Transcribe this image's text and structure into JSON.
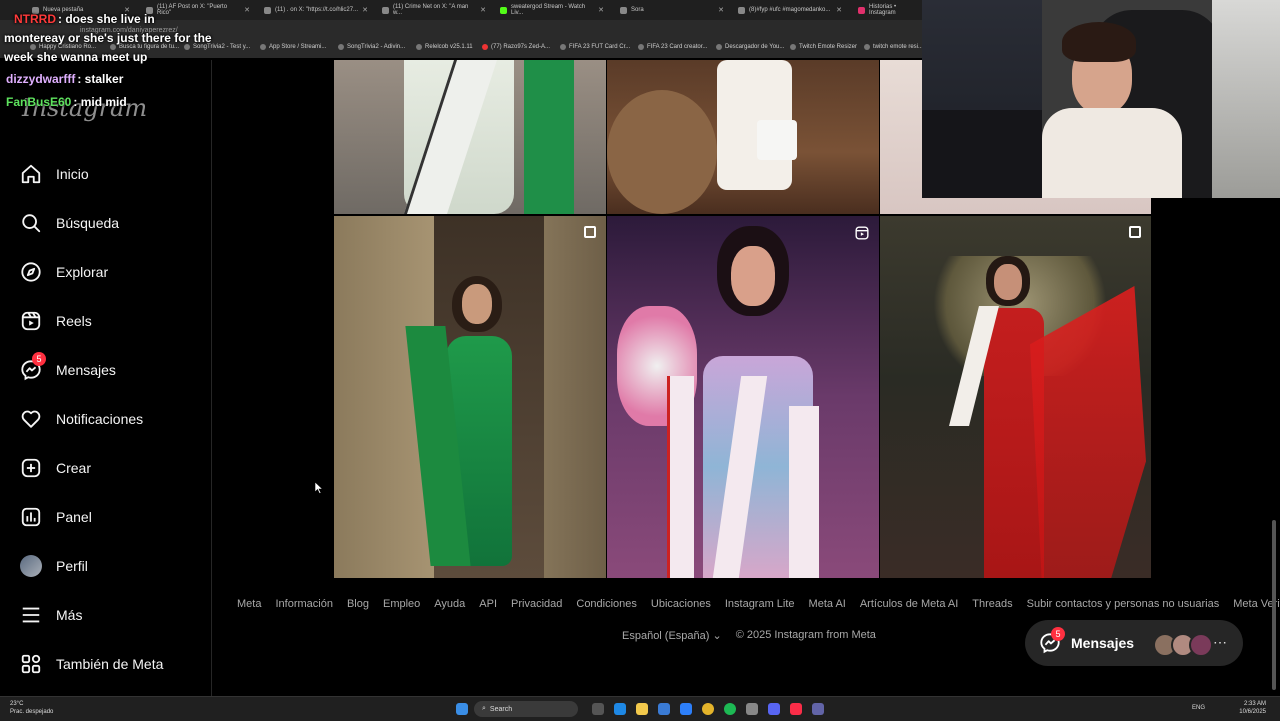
{
  "browser": {
    "tabs": [
      {
        "title": "Nueva pestaña"
      },
      {
        "title": "(11) AF Post on X: \"Puerto Rico\""
      },
      {
        "title": "(11) . on X: \"https://t.co/hlic27..."
      },
      {
        "title": "(11) Crime Net on X: \"A man w..."
      },
      {
        "title": "sweatergod Stream - Watch Liv..."
      },
      {
        "title": "Sora"
      },
      {
        "title": "(8)#fyp #ufc #magomedanko..."
      },
      {
        "title": "Historias • Instagram"
      }
    ],
    "url": "instagram.com/daniyaperezrez/",
    "bookmarks": [
      "Happy Cristiano Ro...",
      "Busca tu figura de tu...",
      "SongTrivia2 - Test y...",
      "App Store / Streami...",
      "SongTrivia2 - Adivin...",
      "Relelcob v25.1.11",
      "(77) Razo97s Zed-A...",
      "FIFA 23 FUT Card Cr...",
      "FIFA 23 Card creator...",
      "Descargador de You...",
      "Twitch Emote Resizer",
      "twitch emote resi..."
    ]
  },
  "chat": [
    {
      "user": "NTRRD",
      "text": ": does she live in",
      "user_color": "#ff3a3a"
    },
    {
      "user": "",
      "text": "montereay or she's just there for the",
      "user_color": "#ffffff"
    },
    {
      "user": "",
      "text": "week she wanna meet up",
      "user_color": "#ffffff"
    },
    {
      "user": "dizzydwarfff",
      "text": ": stalker",
      "user_color": "#e0b0ff"
    },
    {
      "user": "FanBusE60",
      "text": ": mid mid",
      "user_color": "#5ee35e"
    }
  ],
  "sidebar": {
    "logo": "Instagram",
    "items": [
      {
        "label": "Inicio",
        "icon": "home-icon"
      },
      {
        "label": "Búsqueda",
        "icon": "search-icon"
      },
      {
        "label": "Explorar",
        "icon": "compass-icon"
      },
      {
        "label": "Reels",
        "icon": "reels-icon"
      },
      {
        "label": "Mensajes",
        "icon": "messenger-icon",
        "badge": "5"
      },
      {
        "label": "Notificaciones",
        "icon": "heart-icon"
      },
      {
        "label": "Crear",
        "icon": "plus-square-icon"
      },
      {
        "label": "Panel",
        "icon": "chart-icon"
      },
      {
        "label": "Perfil",
        "icon": "avatar"
      },
      {
        "label": "Más",
        "icon": "menu-icon"
      },
      {
        "label": "También de Meta",
        "icon": "meta-apps-icon"
      }
    ]
  },
  "footer": {
    "links": [
      "Meta",
      "Información",
      "Blog",
      "Empleo",
      "Ayuda",
      "API",
      "Privacidad",
      "Condiciones",
      "Ubicaciones",
      "Instagram Lite",
      "Meta AI",
      "Artículos de Meta AI",
      "Threads",
      "Subir contactos y personas no usuarias",
      "Meta Verified"
    ],
    "language": "Español (España)",
    "copyright": "© 2025 Instagram from Meta"
  },
  "messages_button": {
    "label": "Mensajes",
    "badge": "5"
  },
  "taskbar": {
    "weather_temp": "23°C",
    "weather_desc": "Prac. despejado",
    "search_placeholder": "Search",
    "lang": "ENG",
    "time": "2:33 AM",
    "date": "10/6/2025"
  },
  "colors": {
    "accent_badge": "#ff3040",
    "footer_text": "#a8a8a8",
    "background": "#000000"
  }
}
